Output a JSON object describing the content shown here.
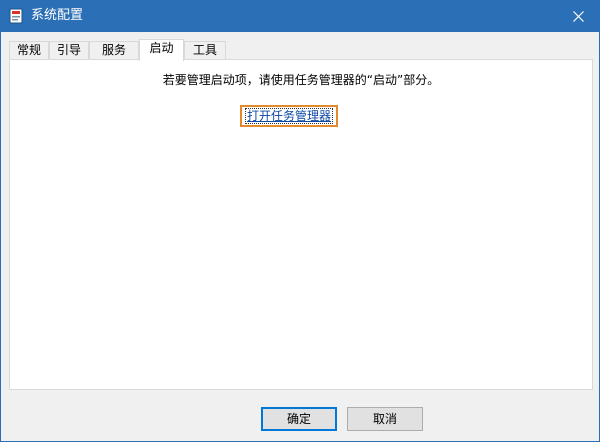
{
  "window": {
    "title": "系统配置"
  },
  "tabs": [
    {
      "label": "常规"
    },
    {
      "label": "引导"
    },
    {
      "label": "服务"
    },
    {
      "label": "启动",
      "active": true
    },
    {
      "label": "工具"
    }
  ],
  "startup_panel": {
    "message": "若要管理启动项，请使用任务管理器的“启动”部分。",
    "link_label": "打开任务管理器"
  },
  "buttons": {
    "ok_label": "确定",
    "cancel_label": "取消"
  },
  "icons": {
    "app": "msconfig-icon",
    "close": "close-icon"
  },
  "colors": {
    "titlebar": "#2b6fb6",
    "link": "#0b49a6",
    "highlight_border": "#e38b2c",
    "primary_button_border": "#0078d7"
  }
}
